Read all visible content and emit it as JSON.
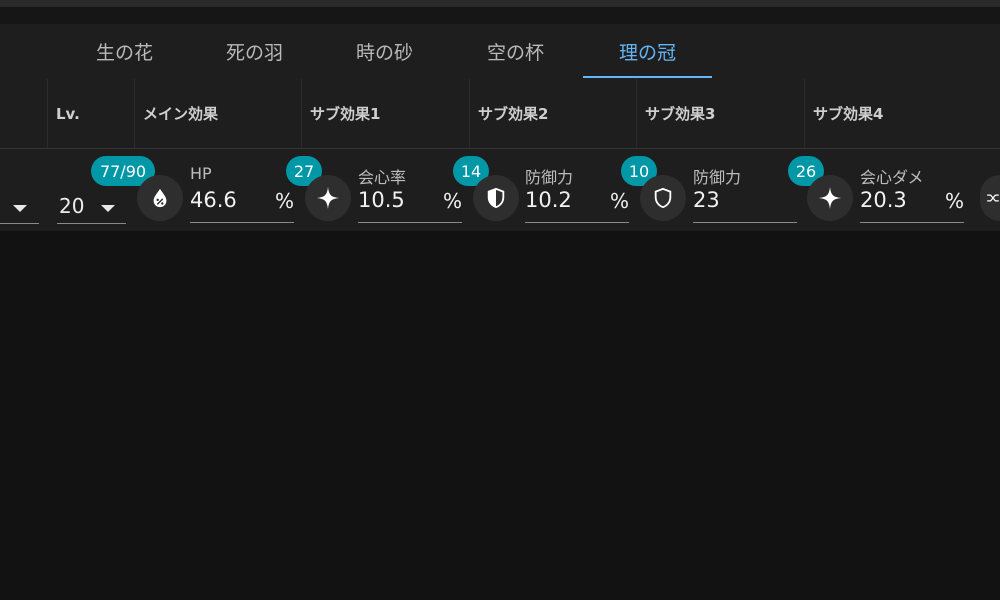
{
  "tabs": [
    {
      "label": "生の花"
    },
    {
      "label": "死の羽"
    },
    {
      "label": "時の砂"
    },
    {
      "label": "空の杯"
    },
    {
      "label": "理の冠"
    }
  ],
  "active_tab": "理の冠",
  "headers": {
    "level": "Lv.",
    "main": "メイン効果",
    "sub1": "サブ効果1",
    "sub2": "サブ効果2",
    "sub3": "サブ効果3",
    "sub4": "サブ効果4"
  },
  "row": {
    "level_value": "20",
    "score_badge": "77/90",
    "main": {
      "label": "HP",
      "value": "46.6",
      "unit": "%",
      "icon": "hp-drop-icon"
    },
    "subs": [
      {
        "badge": "27",
        "label": "会心率",
        "value": "10.5",
        "unit": "%",
        "icon": "sparkle-icon"
      },
      {
        "badge": "14",
        "label": "防御力",
        "value": "10.2",
        "unit": "%",
        "icon": "shield-half-icon"
      },
      {
        "badge": "10",
        "label": "防御力",
        "value": "23",
        "unit": "",
        "icon": "shield-outline-icon"
      },
      {
        "badge": "26",
        "label": "会心ダメ",
        "value": "20.3",
        "unit": "%",
        "icon": "sparkle-icon"
      }
    ]
  },
  "colors": {
    "accent": "#64b5f6",
    "badge": "#0097a7",
    "panel": "#1e1e1e",
    "background": "#121212"
  }
}
